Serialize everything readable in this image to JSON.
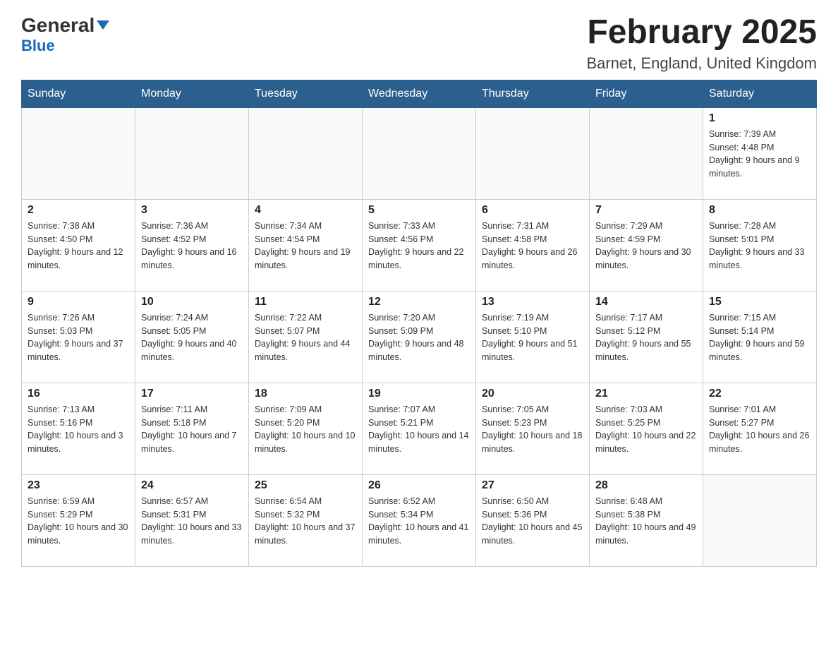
{
  "header": {
    "logo_general": "General",
    "logo_blue": "Blue",
    "title": "February 2025",
    "subtitle": "Barnet, England, United Kingdom"
  },
  "days_of_week": [
    "Sunday",
    "Monday",
    "Tuesday",
    "Wednesday",
    "Thursday",
    "Friday",
    "Saturday"
  ],
  "weeks": [
    [
      {
        "day": "",
        "info": ""
      },
      {
        "day": "",
        "info": ""
      },
      {
        "day": "",
        "info": ""
      },
      {
        "day": "",
        "info": ""
      },
      {
        "day": "",
        "info": ""
      },
      {
        "day": "",
        "info": ""
      },
      {
        "day": "1",
        "info": "Sunrise: 7:39 AM\nSunset: 4:48 PM\nDaylight: 9 hours and 9 minutes."
      }
    ],
    [
      {
        "day": "2",
        "info": "Sunrise: 7:38 AM\nSunset: 4:50 PM\nDaylight: 9 hours and 12 minutes."
      },
      {
        "day": "3",
        "info": "Sunrise: 7:36 AM\nSunset: 4:52 PM\nDaylight: 9 hours and 16 minutes."
      },
      {
        "day": "4",
        "info": "Sunrise: 7:34 AM\nSunset: 4:54 PM\nDaylight: 9 hours and 19 minutes."
      },
      {
        "day": "5",
        "info": "Sunrise: 7:33 AM\nSunset: 4:56 PM\nDaylight: 9 hours and 22 minutes."
      },
      {
        "day": "6",
        "info": "Sunrise: 7:31 AM\nSunset: 4:58 PM\nDaylight: 9 hours and 26 minutes."
      },
      {
        "day": "7",
        "info": "Sunrise: 7:29 AM\nSunset: 4:59 PM\nDaylight: 9 hours and 30 minutes."
      },
      {
        "day": "8",
        "info": "Sunrise: 7:28 AM\nSunset: 5:01 PM\nDaylight: 9 hours and 33 minutes."
      }
    ],
    [
      {
        "day": "9",
        "info": "Sunrise: 7:26 AM\nSunset: 5:03 PM\nDaylight: 9 hours and 37 minutes."
      },
      {
        "day": "10",
        "info": "Sunrise: 7:24 AM\nSunset: 5:05 PM\nDaylight: 9 hours and 40 minutes."
      },
      {
        "day": "11",
        "info": "Sunrise: 7:22 AM\nSunset: 5:07 PM\nDaylight: 9 hours and 44 minutes."
      },
      {
        "day": "12",
        "info": "Sunrise: 7:20 AM\nSunset: 5:09 PM\nDaylight: 9 hours and 48 minutes."
      },
      {
        "day": "13",
        "info": "Sunrise: 7:19 AM\nSunset: 5:10 PM\nDaylight: 9 hours and 51 minutes."
      },
      {
        "day": "14",
        "info": "Sunrise: 7:17 AM\nSunset: 5:12 PM\nDaylight: 9 hours and 55 minutes."
      },
      {
        "day": "15",
        "info": "Sunrise: 7:15 AM\nSunset: 5:14 PM\nDaylight: 9 hours and 59 minutes."
      }
    ],
    [
      {
        "day": "16",
        "info": "Sunrise: 7:13 AM\nSunset: 5:16 PM\nDaylight: 10 hours and 3 minutes."
      },
      {
        "day": "17",
        "info": "Sunrise: 7:11 AM\nSunset: 5:18 PM\nDaylight: 10 hours and 7 minutes."
      },
      {
        "day": "18",
        "info": "Sunrise: 7:09 AM\nSunset: 5:20 PM\nDaylight: 10 hours and 10 minutes."
      },
      {
        "day": "19",
        "info": "Sunrise: 7:07 AM\nSunset: 5:21 PM\nDaylight: 10 hours and 14 minutes."
      },
      {
        "day": "20",
        "info": "Sunrise: 7:05 AM\nSunset: 5:23 PM\nDaylight: 10 hours and 18 minutes."
      },
      {
        "day": "21",
        "info": "Sunrise: 7:03 AM\nSunset: 5:25 PM\nDaylight: 10 hours and 22 minutes."
      },
      {
        "day": "22",
        "info": "Sunrise: 7:01 AM\nSunset: 5:27 PM\nDaylight: 10 hours and 26 minutes."
      }
    ],
    [
      {
        "day": "23",
        "info": "Sunrise: 6:59 AM\nSunset: 5:29 PM\nDaylight: 10 hours and 30 minutes."
      },
      {
        "day": "24",
        "info": "Sunrise: 6:57 AM\nSunset: 5:31 PM\nDaylight: 10 hours and 33 minutes."
      },
      {
        "day": "25",
        "info": "Sunrise: 6:54 AM\nSunset: 5:32 PM\nDaylight: 10 hours and 37 minutes."
      },
      {
        "day": "26",
        "info": "Sunrise: 6:52 AM\nSunset: 5:34 PM\nDaylight: 10 hours and 41 minutes."
      },
      {
        "day": "27",
        "info": "Sunrise: 6:50 AM\nSunset: 5:36 PM\nDaylight: 10 hours and 45 minutes."
      },
      {
        "day": "28",
        "info": "Sunrise: 6:48 AM\nSunset: 5:38 PM\nDaylight: 10 hours and 49 minutes."
      },
      {
        "day": "",
        "info": ""
      }
    ]
  ]
}
